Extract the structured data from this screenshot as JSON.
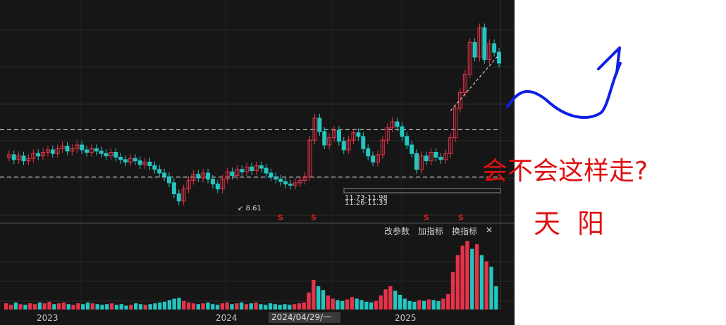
{
  "chart_data": {
    "type": "candlestick",
    "x_ticks": [
      "2023",
      "2024",
      "2025"
    ],
    "cursor_date": "2024/04/29/一",
    "annotations": {
      "low_price": "8.61",
      "zone_label_a": "11.73-11.98",
      "zone_label_b": "11.26-11.33"
    },
    "markers": [
      "S",
      "S",
      "S",
      "S"
    ],
    "toolbar": {
      "param": "改参数",
      "add": "加指标",
      "switch": "换指标",
      "close": "✕"
    },
    "handwritten": {
      "question": "会不会这样走?",
      "name": "天  阳"
    },
    "price_points": [
      12.2,
      12.4,
      12.0,
      12.3,
      11.9,
      12.1,
      12.5,
      12.3,
      12.6,
      12.8,
      12.5,
      12.9,
      13.1,
      12.7,
      12.9,
      13.2,
      12.8,
      12.6,
      12.9,
      12.7,
      12.5,
      12.3,
      12.6,
      12.2,
      12.0,
      11.8,
      12.1,
      11.9,
      11.6,
      11.8,
      11.5,
      11.2,
      10.9,
      10.6,
      10.1,
      9.2,
      8.61,
      9.6,
      10.3,
      10.8,
      10.5,
      10.9,
      10.4,
      10.0,
      9.6,
      10.4,
      11.0,
      10.7,
      11.2,
      11.0,
      11.4,
      11.1,
      11.5,
      11.3,
      10.9,
      10.6,
      10.4,
      10.2,
      10.0,
      9.9,
      10.1,
      10.3,
      10.6,
      13.6,
      15.4,
      14.3,
      13.2,
      13.8,
      14.4,
      13.5,
      12.8,
      13.6,
      14.2,
      13.9,
      12.9,
      12.3,
      11.8,
      12.4,
      13.6,
      14.6,
      15.1,
      14.7,
      13.9,
      13.2,
      12.5,
      11.2,
      12.3,
      11.9,
      12.6,
      12.2,
      12.0,
      12.5,
      13.8,
      16.2,
      17.5,
      19.0,
      21.6,
      20.4,
      22.8,
      20.2,
      21.5,
      20.8,
      19.9
    ],
    "volume": [
      8,
      6,
      9,
      7,
      6,
      8,
      7,
      9,
      8,
      10,
      7,
      8,
      9,
      7,
      6,
      8,
      7,
      9,
      8,
      7,
      6,
      7,
      8,
      6,
      7,
      5,
      6,
      8,
      7,
      6,
      7,
      8,
      9,
      10,
      12,
      14,
      15,
      11,
      9,
      8,
      7,
      8,
      9,
      7,
      6,
      8,
      9,
      7,
      8,
      9,
      7,
      8,
      9,
      7,
      6,
      8,
      7,
      6,
      7,
      6,
      7,
      8,
      9,
      22,
      38,
      30,
      25,
      18,
      14,
      12,
      11,
      13,
      16,
      14,
      12,
      10,
      9,
      11,
      18,
      26,
      30,
      24,
      19,
      14,
      11,
      10,
      12,
      11,
      13,
      12,
      11,
      14,
      20,
      48,
      70,
      82,
      88,
      78,
      84,
      70,
      62,
      55,
      30
    ],
    "support_levels": [
      14.45,
      11.26
    ]
  }
}
